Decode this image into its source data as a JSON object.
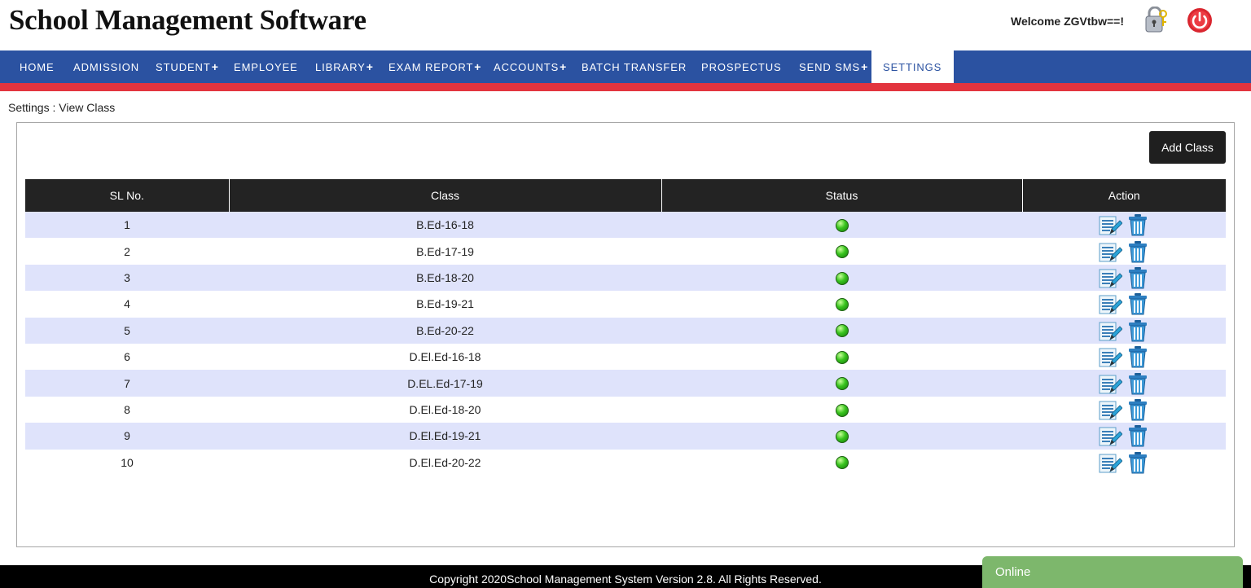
{
  "header": {
    "title": "School Management Software",
    "welcome": "Welcome ZGVtbw==!",
    "password_icon": "lock-key-icon",
    "power_icon": "power-icon",
    "brand_red": "#e2343e"
  },
  "nav": {
    "color": "#2b52a1",
    "items": [
      {
        "label": "HOME",
        "plus": ""
      },
      {
        "label": "ADMISSION",
        "plus": ""
      },
      {
        "label": "STUDENT",
        "plus": "+"
      },
      {
        "label": "EMPLOYEE",
        "plus": ""
      },
      {
        "label": "LIBRARY",
        "plus": "+"
      },
      {
        "label": "EXAM REPORT",
        "plus": "+"
      },
      {
        "label": "ACCOUNTS",
        "plus": "+"
      },
      {
        "label": "BATCH TRANSFER",
        "plus": ""
      },
      {
        "label": "PROSPECTUS",
        "plus": ""
      },
      {
        "label": "SEND SMS",
        "plus": "+"
      },
      {
        "label": "SETTINGS",
        "plus": ""
      }
    ]
  },
  "breadcrumb": "Settings : View Class",
  "toolbar": {
    "add_label": "Add Class"
  },
  "table": {
    "headers": [
      "SL No.",
      "Class",
      "Status",
      "Action"
    ],
    "rows": [
      {
        "sl": "1",
        "class": "B.Ed-16-18"
      },
      {
        "sl": "2",
        "class": "B.Ed-17-19"
      },
      {
        "sl": "3",
        "class": "B.Ed-18-20"
      },
      {
        "sl": "4",
        "class": "B.Ed-19-21"
      },
      {
        "sl": "5",
        "class": "B.Ed-20-22"
      },
      {
        "sl": "6",
        "class": "D.El.Ed-16-18"
      },
      {
        "sl": "7",
        "class": "D.EL.Ed-17-19"
      },
      {
        "sl": "8",
        "class": "D.El.Ed-18-20"
      },
      {
        "sl": "9",
        "class": "D.El.Ed-19-21"
      },
      {
        "sl": "10",
        "class": "D.El.Ed-20-22"
      }
    ],
    "status_icon": "green-status-dot-icon",
    "edit_icon": "edit-icon",
    "delete_icon": "trash-icon",
    "stripe_color": "#dfe3fb"
  },
  "footer": {
    "copyright": "Copyright 2020School Management System Version 2.8. All Rights Reserved."
  },
  "chat": {
    "status": "Online",
    "color": "#7db76c"
  }
}
